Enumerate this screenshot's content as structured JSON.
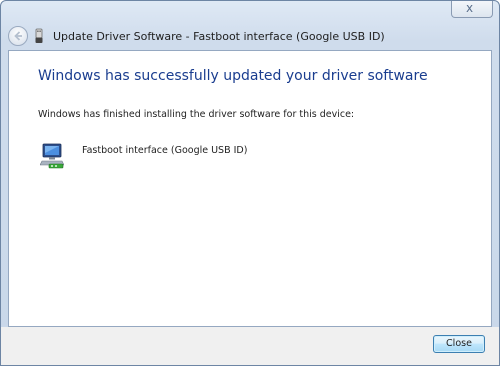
{
  "window": {
    "title": "Update Driver Software - Fastboot interface (Google USB ID)",
    "close_glyph": "x"
  },
  "content": {
    "heading": "Windows has successfully updated your driver software",
    "message": "Windows has finished installing the driver software for this device:",
    "device_name": "Fastboot interface (Google USB ID)"
  },
  "footer": {
    "close_label": "Close"
  },
  "colors": {
    "heading": "#1a3d8f",
    "accent_button": "#a7d9f5"
  },
  "icons": {
    "back": "back-arrow-icon",
    "title": "usb-device-icon",
    "device": "computer-device-icon"
  }
}
